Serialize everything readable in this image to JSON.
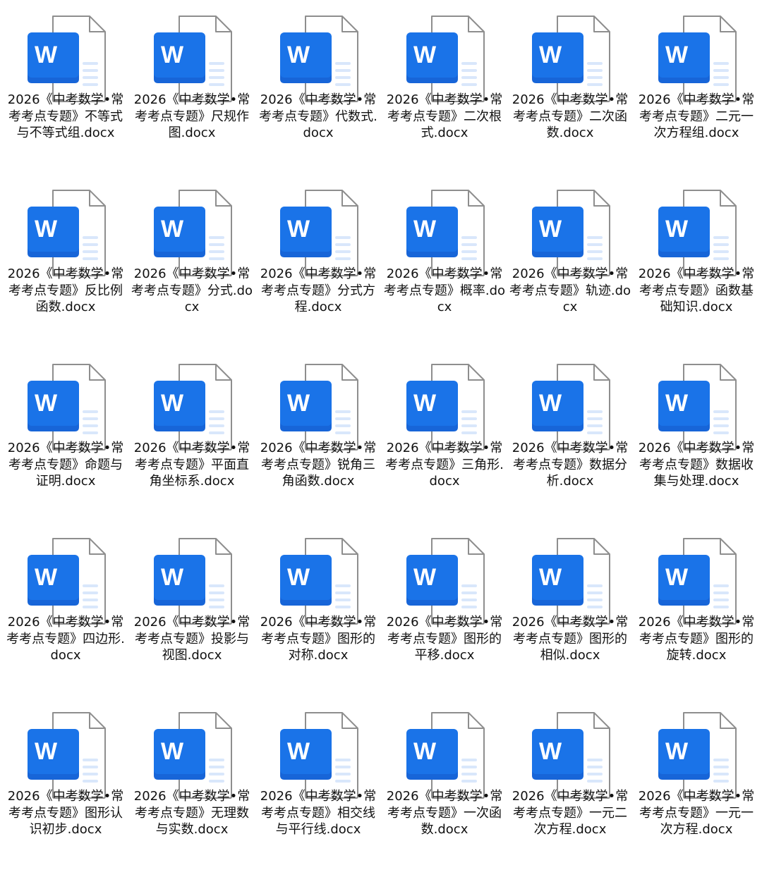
{
  "files": [
    {
      "name": "2026《中考数学•常考考点专题》不等式与不等式组.docx",
      "icon": "word-document-icon"
    },
    {
      "name": "2026《中考数学•常考考点专题》尺规作图.docx",
      "icon": "word-document-icon"
    },
    {
      "name": "2026《中考数学•常考考点专题》代数式.docx",
      "icon": "word-document-icon"
    },
    {
      "name": "2026《中考数学•常考考点专题》二次根式.docx",
      "icon": "word-document-icon"
    },
    {
      "name": "2026《中考数学•常考考点专题》二次函数.docx",
      "icon": "word-document-icon"
    },
    {
      "name": "2026《中考数学•常考考点专题》二元一次方程组.docx",
      "icon": "word-document-icon"
    },
    {
      "name": "2026《中考数学•常考考点专题》反比例函数.docx",
      "icon": "word-document-icon"
    },
    {
      "name": "2026《中考数学•常考考点专题》分式.docx",
      "icon": "word-document-icon"
    },
    {
      "name": "2026《中考数学•常考考点专题》分式方程.docx",
      "icon": "word-document-icon"
    },
    {
      "name": "2026《中考数学•常考考点专题》概率.docx",
      "icon": "word-document-icon"
    },
    {
      "name": "2026《中考数学•常考考点专题》轨迹.docx",
      "icon": "word-document-icon"
    },
    {
      "name": "2026《中考数学•常考考点专题》函数基础知识.docx",
      "icon": "word-document-icon"
    },
    {
      "name": "2026《中考数学•常考考点专题》命题与证明.docx",
      "icon": "word-document-icon"
    },
    {
      "name": "2026《中考数学•常考考点专题》平面直角坐标系.docx",
      "icon": "word-document-icon"
    },
    {
      "name": "2026《中考数学•常考考点专题》锐角三角函数.docx",
      "icon": "word-document-icon"
    },
    {
      "name": "2026《中考数学•常考考点专题》三角形.docx",
      "icon": "word-document-icon"
    },
    {
      "name": "2026《中考数学•常考考点专题》数据分析.docx",
      "icon": "word-document-icon"
    },
    {
      "name": "2026《中考数学•常考考点专题》数据收集与处理.docx",
      "icon": "word-document-icon"
    },
    {
      "name": "2026《中考数学•常考考点专题》四边形.docx",
      "icon": "word-document-icon"
    },
    {
      "name": "2026《中考数学•常考考点专题》投影与视图.docx",
      "icon": "word-document-icon"
    },
    {
      "name": "2026《中考数学•常考考点专题》图形的对称.docx",
      "icon": "word-document-icon"
    },
    {
      "name": "2026《中考数学•常考考点专题》图形的平移.docx",
      "icon": "word-document-icon"
    },
    {
      "name": "2026《中考数学•常考考点专题》图形的相似.docx",
      "icon": "word-document-icon"
    },
    {
      "name": "2026《中考数学•常考考点专题》图形的旋转.docx",
      "icon": "word-document-icon"
    },
    {
      "name": "2026《中考数学•常考考点专题》图形认识初步.docx",
      "icon": "word-document-icon"
    },
    {
      "name": "2026《中考数学•常考考点专题》无理数与实数.docx",
      "icon": "word-document-icon"
    },
    {
      "name": "2026《中考数学•常考考点专题》相交线与平行线.docx",
      "icon": "word-document-icon"
    },
    {
      "name": "2026《中考数学•常考考点专题》一次函数.docx",
      "icon": "word-document-icon"
    },
    {
      "name": "2026《中考数学•常考考点专题》一元二次方程.docx",
      "icon": "word-document-icon"
    },
    {
      "name": "2026《中考数学•常考考点专题》一元一次方程.docx",
      "icon": "word-document-icon"
    }
  ],
  "icon_letter": "W",
  "colors": {
    "word_blue": "#1a73e8",
    "word_blue_dark": "#1765d8",
    "page_outline": "#8e8e8e",
    "page_fill": "#ffffff",
    "page_lines": "#d9e7fb"
  }
}
